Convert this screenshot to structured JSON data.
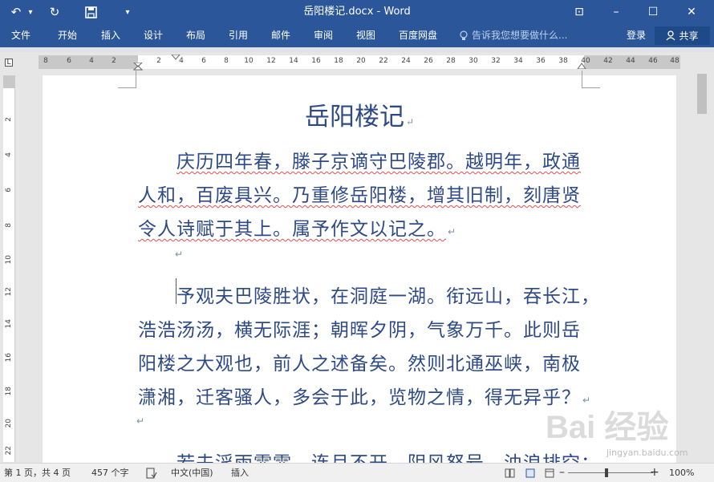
{
  "window": {
    "title": "岳阳楼记.docx - Word",
    "controls": {
      "ribbon_options": "⊡",
      "minimize": "–",
      "maximize": "☐",
      "close": "✕"
    }
  },
  "quick_access": {
    "undo": "↶",
    "undo_dropdown": "▾",
    "redo": "↻",
    "save": "💾",
    "customize": "▾"
  },
  "ribbon": {
    "tabs": [
      "文件",
      "开始",
      "插入",
      "设计",
      "布局",
      "引用",
      "邮件",
      "审阅",
      "视图",
      "百度网盘"
    ],
    "tell_me_placeholder": "告诉我您想要做什么...",
    "login_label": "登录",
    "share_label": "共享"
  },
  "ruler": {
    "tab_selector": "L",
    "horizontal_marks": [
      "8",
      "6",
      "4",
      "2",
      "2",
      "4",
      "6",
      "8",
      "10",
      "12",
      "14",
      "16",
      "18",
      "20",
      "22",
      "24",
      "26",
      "28",
      "30",
      "32",
      "34",
      "36",
      "38",
      "40",
      "42",
      "44",
      "46",
      "48"
    ],
    "vertical_marks": [
      "2",
      "4",
      "6",
      "8",
      "10",
      "12",
      "14",
      "16",
      "18",
      "20",
      "22"
    ]
  },
  "document": {
    "title": "岳阳楼记",
    "paragraphs": [
      {
        "lines": [
          "庆历四年春，滕子京谪守巴陵郡。越明年，政通",
          "人和，百废具兴。乃重修岳阳楼，增其旧制，刻唐贤",
          "令人诗赋于其上。属予作文以记之。"
        ]
      },
      {
        "lines": [
          "予观夫巴陵胜状，在洞庭一湖。衔远山，吞长江，",
          "浩浩汤汤，横无际涯；朝晖夕阴，气象万千。此则岳",
          "阳楼之大观也，前人之述备矣。然则北通巫峡，南极",
          "潇湘，迁客骚人，多会于此，览物之情，得无异乎？"
        ]
      },
      {
        "lines": [
          "若夫淫雨霏霏，连月不开，阴风怒号，浊浪排空；"
        ]
      }
    ],
    "paragraph_mark": "↵"
  },
  "status_bar": {
    "page_info": "第 1 页，共 4 页",
    "word_count": "457 个字",
    "language": "中文(中国)",
    "mode": "插入",
    "zoom_minus": "–",
    "zoom_plus": "+",
    "zoom_level": "100%"
  },
  "watermark": {
    "main": "Bai  经验",
    "sub": "jingyan.baidu.com"
  }
}
